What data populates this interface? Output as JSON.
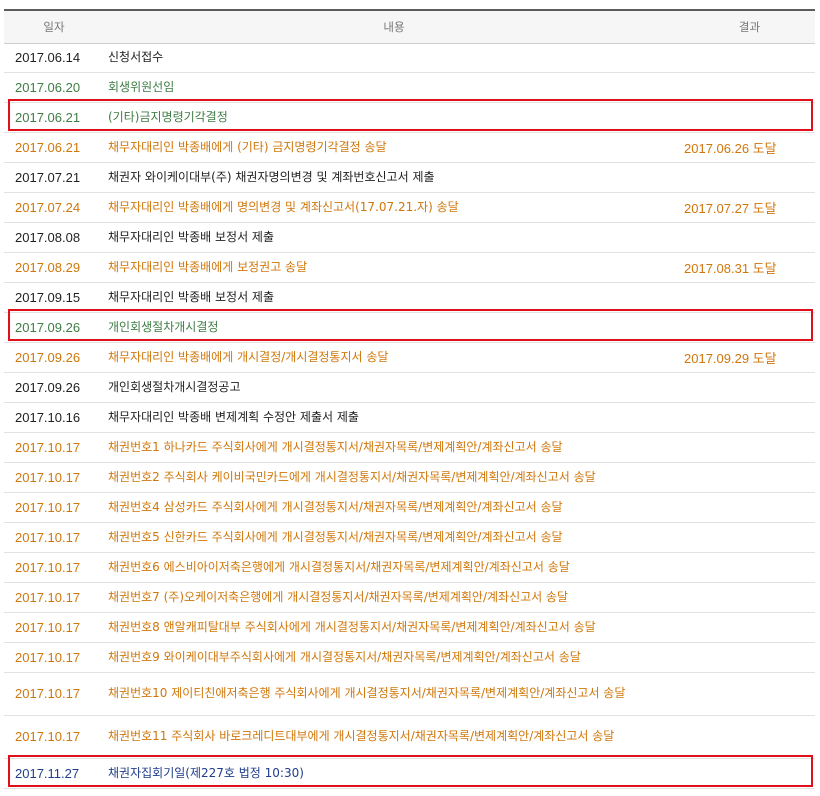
{
  "headers": {
    "date": "일자",
    "content": "내용",
    "result": "결과"
  },
  "colors": {
    "black": "#1f1f1f",
    "green": "#3f7d45",
    "orange": "#d0770b",
    "blue": "#1f3d8c",
    "highlight": "#e0101a"
  },
  "rows": [
    {
      "date": "2017.06.14",
      "content": "신청서접수",
      "result": "",
      "color": "black",
      "highlighted": false
    },
    {
      "date": "2017.06.20",
      "content": "회생위원선임",
      "result": "",
      "color": "green",
      "highlighted": false
    },
    {
      "date": "2017.06.21",
      "content": "(기타)금지명령기각결정",
      "result": "",
      "color": "green",
      "highlighted": true
    },
    {
      "date": "2017.06.21",
      "content": "채무자대리인 박종배에게 (기타) 금지명령기각결정 송달",
      "result": "2017.06.26 도달",
      "color": "orange",
      "highlighted": false
    },
    {
      "date": "2017.07.21",
      "content": "채권자 와이케이대부(주) 채권자명의변경 및 계좌번호신고서 제출",
      "result": "",
      "color": "black",
      "highlighted": false
    },
    {
      "date": "2017.07.24",
      "content": "채무자대리인 박종배에게 명의변경 및 계좌신고서(17.07.21.자) 송달",
      "result": "2017.07.27 도달",
      "color": "orange",
      "highlighted": false
    },
    {
      "date": "2017.08.08",
      "content": "채무자대리인 박종배 보정서 제출",
      "result": "",
      "color": "black",
      "highlighted": false
    },
    {
      "date": "2017.08.29",
      "content": "채무자대리인 박종배에게 보정권고 송달",
      "result": "2017.08.31 도달",
      "color": "orange",
      "highlighted": false
    },
    {
      "date": "2017.09.15",
      "content": "채무자대리인 박종배 보정서 제출",
      "result": "",
      "color": "black",
      "highlighted": false
    },
    {
      "date": "2017.09.26",
      "content": "개인회생절차개시결정",
      "result": "",
      "color": "green",
      "highlighted": true
    },
    {
      "date": "2017.09.26",
      "content": "채무자대리인 박종배에게 개시결정/개시결정통지서 송달",
      "result": "2017.09.29 도달",
      "color": "orange",
      "highlighted": false
    },
    {
      "date": "2017.09.26",
      "content": "개인회생절차개시결정공고",
      "result": "",
      "color": "black",
      "highlighted": false
    },
    {
      "date": "2017.10.16",
      "content": "채무자대리인 박종배 변제계획 수정안 제출서 제출",
      "result": "",
      "color": "black",
      "highlighted": false
    },
    {
      "date": "2017.10.17",
      "content": "채권번호1 하나카드 주식회사에게 개시결정통지서/채권자목록/변제계획안/계좌신고서 송달",
      "result": "",
      "color": "orange",
      "highlighted": false
    },
    {
      "date": "2017.10.17",
      "content": "채권번호2 주식회사 케이비국민카드에게 개시결정통지서/채권자목록/변제계획안/계좌신고서 송달",
      "result": "",
      "color": "orange",
      "highlighted": false
    },
    {
      "date": "2017.10.17",
      "content": "채권번호4 삼성카드 주식회사에게 개시결정통지서/채권자목록/변제계획안/계좌신고서 송달",
      "result": "",
      "color": "orange",
      "highlighted": false
    },
    {
      "date": "2017.10.17",
      "content": "채권번호5 신한카드 주식회사에게 개시결정통지서/채권자목록/변제계획안/계좌신고서 송달",
      "result": "",
      "color": "orange",
      "highlighted": false
    },
    {
      "date": "2017.10.17",
      "content": "채권번호6 에스비아이저축은행에게 개시결정통지서/채권자목록/변제계획안/계좌신고서 송달",
      "result": "",
      "color": "orange",
      "highlighted": false
    },
    {
      "date": "2017.10.17",
      "content": "채권번호7 (주)오케이저축은행에게 개시결정통지서/채권자목록/변제계획안/계좌신고서 송달",
      "result": "",
      "color": "orange",
      "highlighted": false
    },
    {
      "date": "2017.10.17",
      "content": "채권번호8 앤알캐피탈대부 주식회사에게 개시결정통지서/채권자목록/변제계획안/계좌신고서 송달",
      "result": "",
      "color": "orange",
      "highlighted": false
    },
    {
      "date": "2017.10.17",
      "content": "채권번호9 와이케이대부주식회사에게 개시결정통지서/채권자목록/변제계획안/계좌신고서 송달",
      "result": "",
      "color": "orange",
      "highlighted": false
    },
    {
      "date": "2017.10.17",
      "content": "채권번호10 제이티친애저축은행 주식회사에게 개시결정통지서/채권자목록/변제계획안/계좌신고서 송달",
      "result": "",
      "color": "orange",
      "highlighted": false
    },
    {
      "date": "2017.10.17",
      "content": "채권번호11 주식회사 바로크레디트대부에게 개시결정통지서/채권자목록/변제계획안/계좌신고서 송달",
      "result": "",
      "color": "orange",
      "highlighted": false
    },
    {
      "date": "2017.11.27",
      "content": "채권자집회기일(제227호 법정 10:30)",
      "result": "",
      "color": "blue",
      "highlighted": true
    }
  ]
}
